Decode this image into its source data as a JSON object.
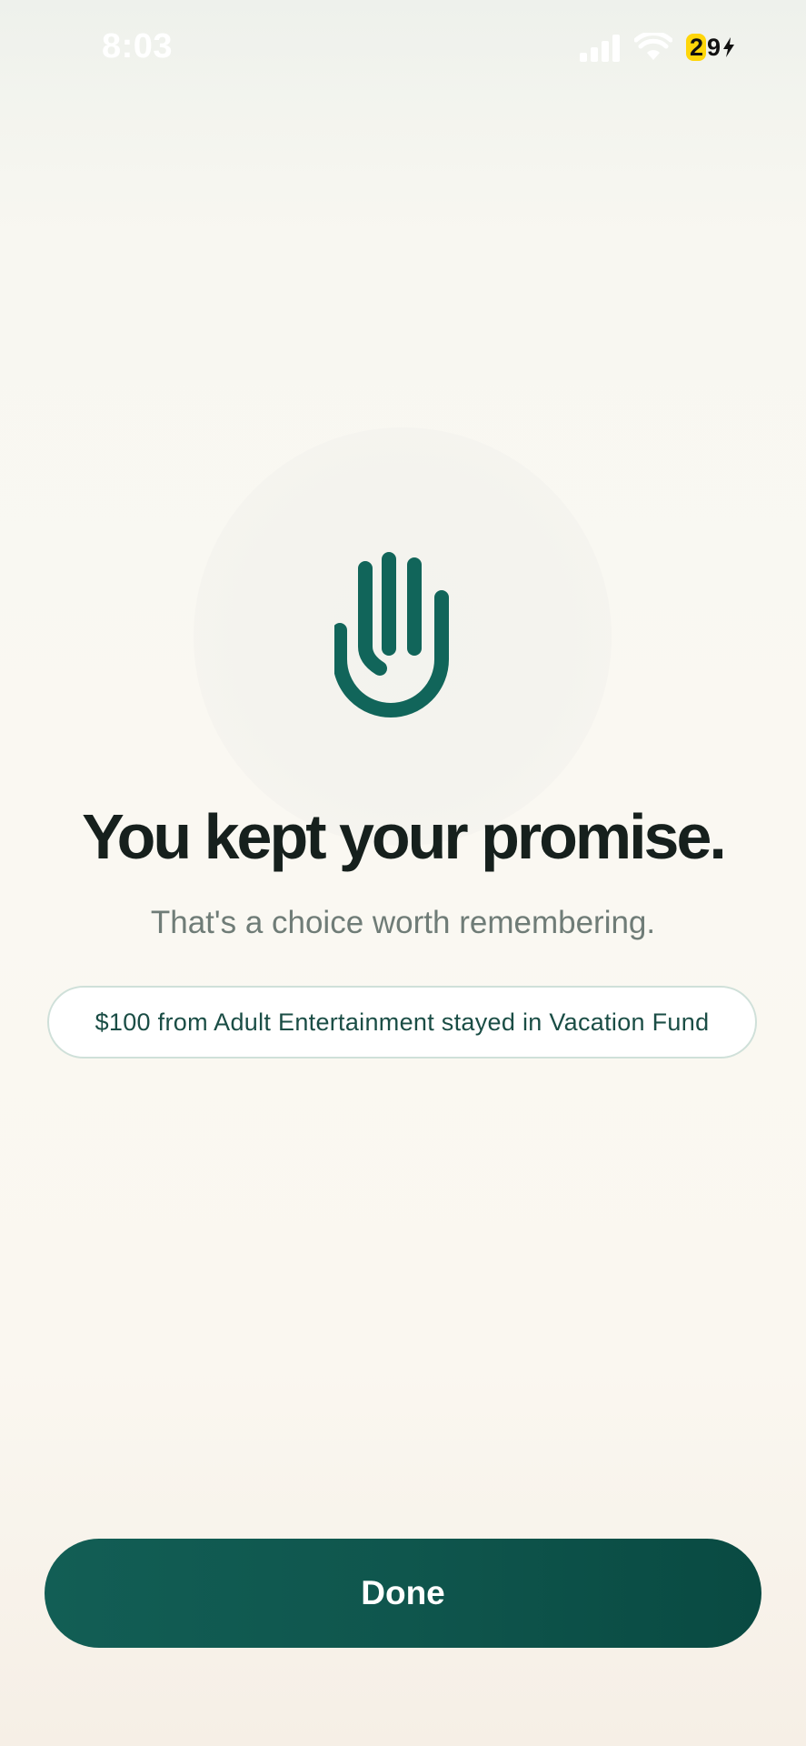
{
  "status_bar": {
    "time": "8:03",
    "battery_level": "29",
    "battery_first_digit": "2",
    "battery_rest": "9",
    "icons": [
      "signal-icon",
      "wifi-icon",
      "charging-bolt-icon"
    ],
    "battery_highlight_color": "#ffd60a"
  },
  "hero": {
    "icon": "raised-hand-icon",
    "icon_color": "#11655a",
    "title": "You kept your promise.",
    "subtitle": "That's a choice worth remembering."
  },
  "summary": {
    "text": "$100 from Adult Entertainment stayed in Vacation Fund"
  },
  "actions": {
    "done_label": "Done",
    "accent_color": "#0f584f"
  }
}
